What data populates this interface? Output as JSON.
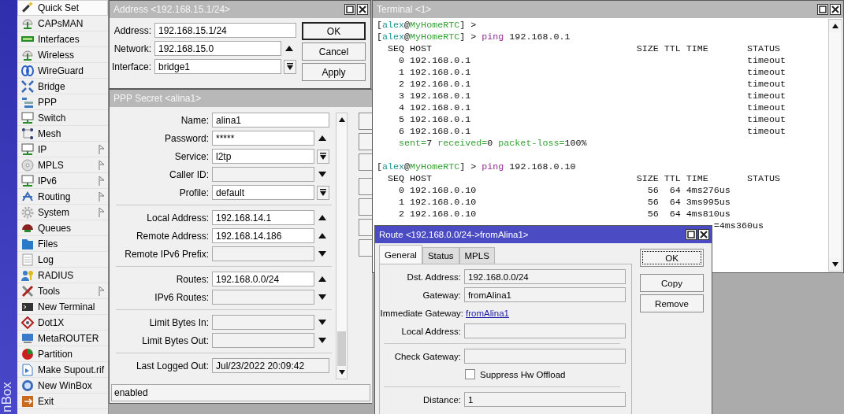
{
  "sidebar": {
    "brand": "nBox",
    "items": [
      {
        "label": "Quick Set",
        "has_submenu": false,
        "selected": true
      },
      {
        "label": "CAPsMAN",
        "has_submenu": false,
        "selected": false
      },
      {
        "label": "Interfaces",
        "has_submenu": false,
        "selected": false
      },
      {
        "label": "Wireless",
        "has_submenu": false,
        "selected": false
      },
      {
        "label": "WireGuard",
        "has_submenu": false,
        "selected": false
      },
      {
        "label": "Bridge",
        "has_submenu": false,
        "selected": false
      },
      {
        "label": "PPP",
        "has_submenu": false,
        "selected": false
      },
      {
        "label": "Switch",
        "has_submenu": false,
        "selected": false
      },
      {
        "label": "Mesh",
        "has_submenu": false,
        "selected": false
      },
      {
        "label": "IP",
        "has_submenu": true,
        "selected": false
      },
      {
        "label": "MPLS",
        "has_submenu": true,
        "selected": false
      },
      {
        "label": "IPv6",
        "has_submenu": true,
        "selected": false
      },
      {
        "label": "Routing",
        "has_submenu": true,
        "selected": false
      },
      {
        "label": "System",
        "has_submenu": true,
        "selected": false
      },
      {
        "label": "Queues",
        "has_submenu": false,
        "selected": false
      },
      {
        "label": "Files",
        "has_submenu": false,
        "selected": false
      },
      {
        "label": "Log",
        "has_submenu": false,
        "selected": false
      },
      {
        "label": "RADIUS",
        "has_submenu": false,
        "selected": false
      },
      {
        "label": "Tools",
        "has_submenu": true,
        "selected": false
      },
      {
        "label": "New Terminal",
        "has_submenu": false,
        "selected": false
      },
      {
        "label": "Dot1X",
        "has_submenu": false,
        "selected": false
      },
      {
        "label": "MetaROUTER",
        "has_submenu": false,
        "selected": false
      },
      {
        "label": "Partition",
        "has_submenu": false,
        "selected": false
      },
      {
        "label": "Make Supout.rif",
        "has_submenu": false,
        "selected": false
      },
      {
        "label": "New WinBox",
        "has_submenu": false,
        "selected": false
      },
      {
        "label": "Exit",
        "has_submenu": false,
        "selected": false
      }
    ]
  },
  "address_window": {
    "title": "Address <192.168.15.1/24>",
    "active": false,
    "fields": [
      {
        "label": "Address:",
        "value": "192.168.15.1/24",
        "kind": "plain",
        "readonly": false
      },
      {
        "label": "Network:",
        "value": "192.168.15.0",
        "kind": "up",
        "readonly": false
      },
      {
        "label": "Interface:",
        "value": "bridge1",
        "kind": "dropdown",
        "readonly": false
      }
    ],
    "buttons": [
      {
        "label": "OK",
        "default": true
      },
      {
        "label": "Cancel",
        "default": false
      },
      {
        "label": "Apply",
        "default": false
      }
    ]
  },
  "ppp_secret_window": {
    "title": "PPP Secret <alina1>",
    "active": false,
    "groups": [
      {
        "fields": [
          {
            "label": "Name:",
            "value": "alina1",
            "kind": "plain",
            "readonly": false
          },
          {
            "label": "Password:",
            "value": "*****",
            "kind": "up",
            "readonly": false
          },
          {
            "label": "Service:",
            "value": "l2tp",
            "kind": "dropdown",
            "readonly": false
          },
          {
            "label": "Caller ID:",
            "kind": "down",
            "readonly": true
          },
          {
            "label": "Profile:",
            "value": "default",
            "kind": "dropdown",
            "readonly": false
          }
        ]
      },
      {
        "fields": [
          {
            "label": "Local Address:",
            "value": "192.168.14.1",
            "kind": "up",
            "readonly": false
          },
          {
            "label": "Remote Address:",
            "value": "192.168.14.186",
            "kind": "up",
            "readonly": false
          },
          {
            "label": "Remote IPv6 Prefix:",
            "kind": "down",
            "readonly": true
          }
        ]
      },
      {
        "fields": [
          {
            "label": "Routes:",
            "value": "192.168.0.0/24",
            "kind": "up",
            "readonly": false
          },
          {
            "label": "IPv6 Routes:",
            "kind": "down",
            "readonly": true
          }
        ]
      },
      {
        "fields": [
          {
            "label": "Limit Bytes In:",
            "kind": "down",
            "readonly": true
          },
          {
            "label": "Limit Bytes Out:",
            "kind": "down",
            "readonly": true
          }
        ]
      },
      {
        "fields": [
          {
            "label": "Last Logged Out:",
            "value": "Jul/23/2022 20:09:42",
            "kind": "plain",
            "readonly": true
          }
        ]
      }
    ],
    "status": "enabled"
  },
  "terminal_window": {
    "title": "Terminal <1>",
    "active": false,
    "lines": [
      {
        "kind": "full",
        "segments": [
          {
            "text": "[",
            "kind": "plain"
          },
          {
            "text": "alex",
            "kind": "user"
          },
          {
            "text": "@",
            "kind": "plain"
          },
          {
            "text": "MyHomeRTC",
            "kind": "host"
          },
          {
            "text": "] >",
            "kind": "plain"
          }
        ]
      },
      {
        "kind": "full",
        "segments": [
          {
            "text": "[",
            "kind": "plain"
          },
          {
            "text": "alex",
            "kind": "user"
          },
          {
            "text": "@",
            "kind": "plain"
          },
          {
            "text": "MyHomeRTC",
            "kind": "host"
          },
          {
            "text": "] > ",
            "kind": "plain"
          },
          {
            "text": "ping",
            "kind": "command"
          },
          {
            "text": " 192.168.0.1",
            "kind": "plain"
          }
        ]
      },
      {
        "kind": "full",
        "segments": [
          {
            "text": "  SEQ HOST                                     SIZE TTL TIME       STATUS",
            "kind": "plain"
          }
        ]
      },
      {
        "kind": "full",
        "segments": [
          {
            "text": "    0 192.168.0.1                                                  timeout",
            "kind": "plain"
          }
        ]
      },
      {
        "kind": "full",
        "segments": [
          {
            "text": "    1 192.168.0.1                                                  timeout",
            "kind": "plain"
          }
        ]
      },
      {
        "kind": "full",
        "segments": [
          {
            "text": "    2 192.168.0.1                                                  timeout",
            "kind": "plain"
          }
        ]
      },
      {
        "kind": "full",
        "segments": [
          {
            "text": "    3 192.168.0.1                                                  timeout",
            "kind": "plain"
          }
        ]
      },
      {
        "kind": "full",
        "segments": [
          {
            "text": "    4 192.168.0.1                                                  timeout",
            "kind": "plain"
          }
        ]
      },
      {
        "kind": "full",
        "segments": [
          {
            "text": "    5 192.168.0.1                                                  timeout",
            "kind": "plain"
          }
        ]
      },
      {
        "kind": "full",
        "segments": [
          {
            "text": "    6 192.168.0.1                                                  timeout",
            "kind": "plain"
          }
        ]
      },
      {
        "kind": "full",
        "segments": [
          {
            "text": "    sent=",
            "kind": "stat"
          },
          {
            "text": "7",
            "kind": "plain"
          },
          {
            "text": " received=",
            "kind": "stat"
          },
          {
            "text": "0",
            "kind": "plain"
          },
          {
            "text": " packet-loss=",
            "kind": "stat"
          },
          {
            "text": "100%",
            "kind": "plain"
          }
        ]
      },
      {
        "kind": "blank"
      },
      {
        "kind": "full",
        "segments": [
          {
            "text": "[",
            "kind": "plain"
          },
          {
            "text": "alex",
            "kind": "user"
          },
          {
            "text": "@",
            "kind": "plain"
          },
          {
            "text": "MyHomeRTC",
            "kind": "host"
          },
          {
            "text": "] > ",
            "kind": "plain"
          },
          {
            "text": "ping",
            "kind": "command"
          },
          {
            "text": " 192.168.0.10",
            "kind": "plain"
          }
        ]
      },
      {
        "kind": "full",
        "segments": [
          {
            "text": "  SEQ HOST                                     SIZE TTL TIME       STATUS",
            "kind": "plain"
          }
        ]
      },
      {
        "kind": "full",
        "segments": [
          {
            "text": "    0 192.168.0.10                               56  64 4ms276us",
            "kind": "plain"
          }
        ]
      },
      {
        "kind": "full",
        "segments": [
          {
            "text": "    1 192.168.0.10                               56  64 3ms995us",
            "kind": "plain"
          }
        ]
      },
      {
        "kind": "full",
        "segments": [
          {
            "text": "    2 192.168.0.10                               56  64 4ms810us",
            "kind": "plain"
          }
        ]
      },
      {
        "kind": "tail",
        "segments": [
          {
            "text": "=4ms360us",
            "kind": "plain"
          }
        ]
      }
    ]
  },
  "route_window": {
    "title": "Route <192.168.0.0/24->fromAlina1>",
    "active": true,
    "tabs": [
      {
        "label": "General",
        "selected": true
      },
      {
        "label": "Status",
        "selected": false
      },
      {
        "label": "MPLS",
        "selected": false
      }
    ],
    "groups": [
      {
        "rows": [
          {
            "kind": "field",
            "label": "Dst. Address:",
            "value": "192.168.0.0/24"
          },
          {
            "kind": "field",
            "label": "Gateway:",
            "value": "fromAlina1"
          },
          {
            "kind": "link",
            "label": "Immediate Gateway:",
            "value": "fromAlina1"
          },
          {
            "kind": "field",
            "label": "Local Address:"
          }
        ]
      },
      {
        "rows": [
          {
            "kind": "field",
            "label": "Check Gateway:"
          },
          {
            "kind": "checkbox",
            "label": "Suppress Hw Offload",
            "checked": false
          }
        ]
      },
      {
        "rows": [
          {
            "kind": "field",
            "label": "Distance:",
            "value": "1"
          }
        ]
      }
    ],
    "buttons": [
      {
        "label": "OK",
        "focused": true
      },
      {
        "label": "Copy",
        "focused": false
      },
      {
        "label": "Remove",
        "focused": false
      }
    ]
  }
}
